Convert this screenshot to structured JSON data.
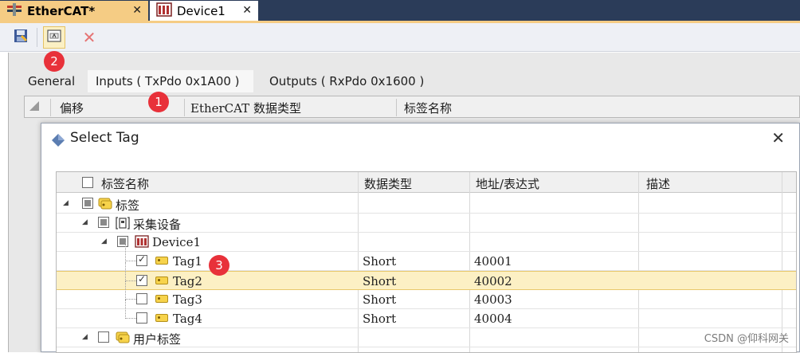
{
  "tabs": [
    {
      "label": "EtherCAT*",
      "active": true
    },
    {
      "label": "Device1",
      "active": false
    }
  ],
  "toolbar": {
    "buttons": [
      "save-icon",
      "select-tag-icon",
      "delete-icon"
    ]
  },
  "pane_tabs": [
    "General",
    "Inputs ( TxPdo 0x1A00 )",
    "Outputs ( RxPdo 0x1600 )"
  ],
  "grid_headers": [
    "偏移",
    "EtherCAT 数据类型",
    "标签名称"
  ],
  "dialog": {
    "title": "Select Tag",
    "columns": [
      "标签名称",
      "数据类型",
      "地址/表达式",
      "描述"
    ],
    "rows": [
      {
        "name": "标签",
        "type": "",
        "address": "",
        "desc": ""
      },
      {
        "name": "采集设备",
        "type": "",
        "address": "",
        "desc": ""
      },
      {
        "name": "Device1",
        "type": "",
        "address": "",
        "desc": ""
      },
      {
        "name": "Tag1",
        "type": "Short",
        "address": "40001",
        "desc": "",
        "checked": true
      },
      {
        "name": "Tag2",
        "type": "Short",
        "address": "40002",
        "desc": "",
        "checked": true,
        "selected": true
      },
      {
        "name": "Tag3",
        "type": "Short",
        "address": "40003",
        "desc": "",
        "checked": false
      },
      {
        "name": "Tag4",
        "type": "Short",
        "address": "40004",
        "desc": "",
        "checked": false
      },
      {
        "name": "用户标签",
        "type": "",
        "address": "",
        "desc": ""
      }
    ]
  },
  "badges": [
    "1",
    "2",
    "3"
  ],
  "watermark": "CSDN @仰科网关",
  "colors": {
    "accent_tab": "#f5cc84",
    "title_bar": "#2b3c59",
    "selection": "#fcf0c4",
    "badge": "#e8313a"
  }
}
